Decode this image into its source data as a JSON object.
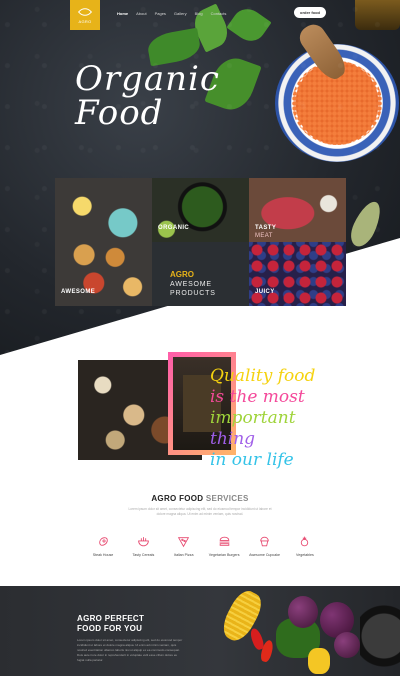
{
  "header": {
    "logo_text": "AGRO",
    "nav": [
      "Home",
      "About",
      "Pages",
      "Gallery",
      "Blog",
      "Contacts"
    ],
    "cta_label": "order food"
  },
  "hero": {
    "title_line1": "Organic",
    "title_line2": "Food"
  },
  "products": {
    "awesome": "AWESOME",
    "organic": "ORGANIC",
    "tasty": "TASTY",
    "tasty_sub": "MEAT",
    "juicy": "JUICY",
    "agro_label": "AGRO",
    "agro_sub_line1": "AWESOME",
    "agro_sub_line2": "PRODUCTS"
  },
  "quality": {
    "lines": [
      "Quality food",
      "is the most",
      "important",
      "thing",
      "in our life"
    ]
  },
  "services": {
    "title_strong": "AGRO FOOD",
    "title_light": "SERVICES",
    "description": "Lorem ipsum dolor sit amet, consectetur adipiscing elit, sed do eiusmod tempor incididunt ut labore et dolore magna aliqua. Ut enim ad minim veniam, quis nostrud.",
    "items": [
      {
        "label": "Steak House",
        "icon": "steak-icon"
      },
      {
        "label": "Tasty Cereals",
        "icon": "cereals-icon"
      },
      {
        "label": "Italian Pizza",
        "icon": "pizza-icon"
      },
      {
        "label": "Vegetarian Burgers",
        "icon": "burger-icon"
      },
      {
        "label": "Awesome Cupcake",
        "icon": "cupcake-icon"
      },
      {
        "label": "Vegetables",
        "icon": "vegetables-icon"
      }
    ],
    "icon_color": "#e7486f"
  },
  "perfect": {
    "title_line1": "AGRO PERFECT",
    "title_line2": "FOOD FOR YOU",
    "text": "Lorem ipsum dolor sit amet, consectetur adipiscing elit, sed do eiusmod tempor incididunt ut labore et dolore magna aliqua. Ut enim ad minim veniam, quis nostrud exercitation ullamco laboris nisi ut aliquip ex ea commodo consequat. Duis aute irure dolor in reprehenderit in voluptate velit esse cillum dolore eu fugiat nulla pariatur."
  },
  "colors": {
    "accent": "#e7b319",
    "hero_bg": "#23272d",
    "quality_yellow": "#f5d20f",
    "quality_pink": "#f4499a",
    "quality_green": "#9fd43a",
    "quality_purple": "#a05fe8",
    "quality_blue": "#34c3e8"
  }
}
